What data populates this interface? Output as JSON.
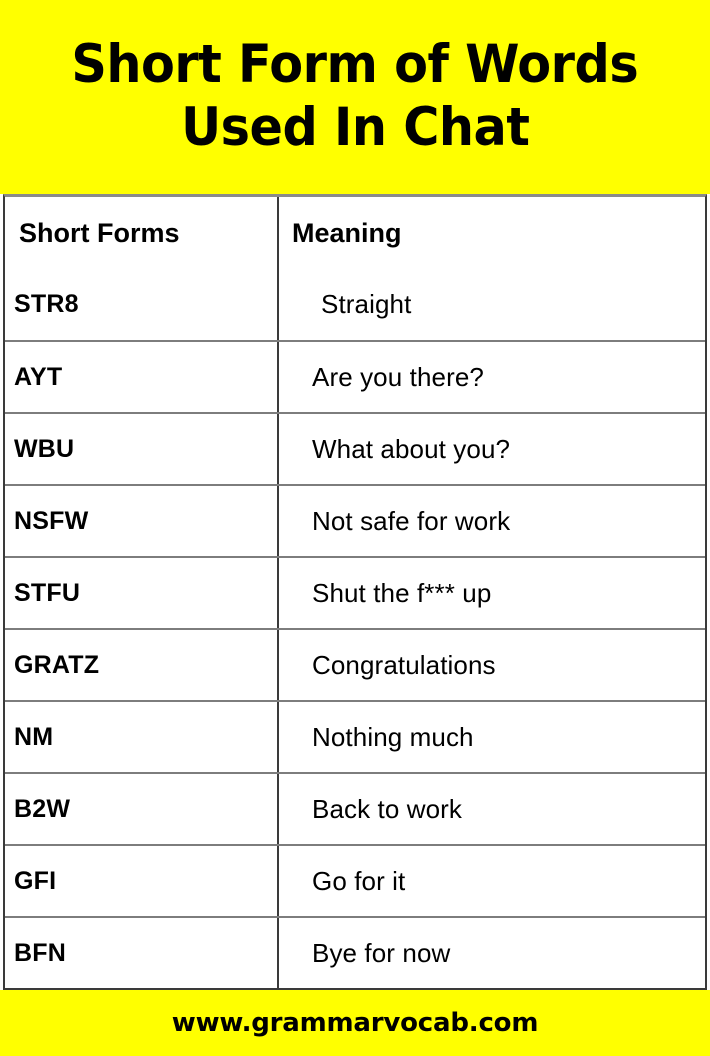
{
  "colors": {
    "accent_yellow": "#FFFF00",
    "text": "#000000",
    "table_border": "#3a3a3a",
    "row_divider": "#7d7d7d",
    "background": "#FFFFFF"
  },
  "title": {
    "line1": "Short Form of Words",
    "line2": "Used In Chat",
    "full": "Short Form of Words Used In Chat"
  },
  "table": {
    "columns": [
      "Short Forms",
      "Meaning"
    ],
    "rows": [
      {
        "short_form": "STR8",
        "meaning": "Straight"
      },
      {
        "short_form": "AYT",
        "meaning": "Are you there?"
      },
      {
        "short_form": "WBU",
        "meaning": "What about you?"
      },
      {
        "short_form": "NSFW",
        "meaning": "Not safe for work"
      },
      {
        "short_form": "STFU",
        "meaning": "Shut the f*** up"
      },
      {
        "short_form": "GRATZ",
        "meaning": "Congratulations"
      },
      {
        "short_form": "NM",
        "meaning": "Nothing much"
      },
      {
        "short_form": "B2W",
        "meaning": "Back to work"
      },
      {
        "short_form": "GFI",
        "meaning": "Go for it"
      },
      {
        "short_form": "BFN",
        "meaning": "Bye for now"
      }
    ]
  },
  "footer": {
    "website": "www.grammarvocab.com"
  }
}
